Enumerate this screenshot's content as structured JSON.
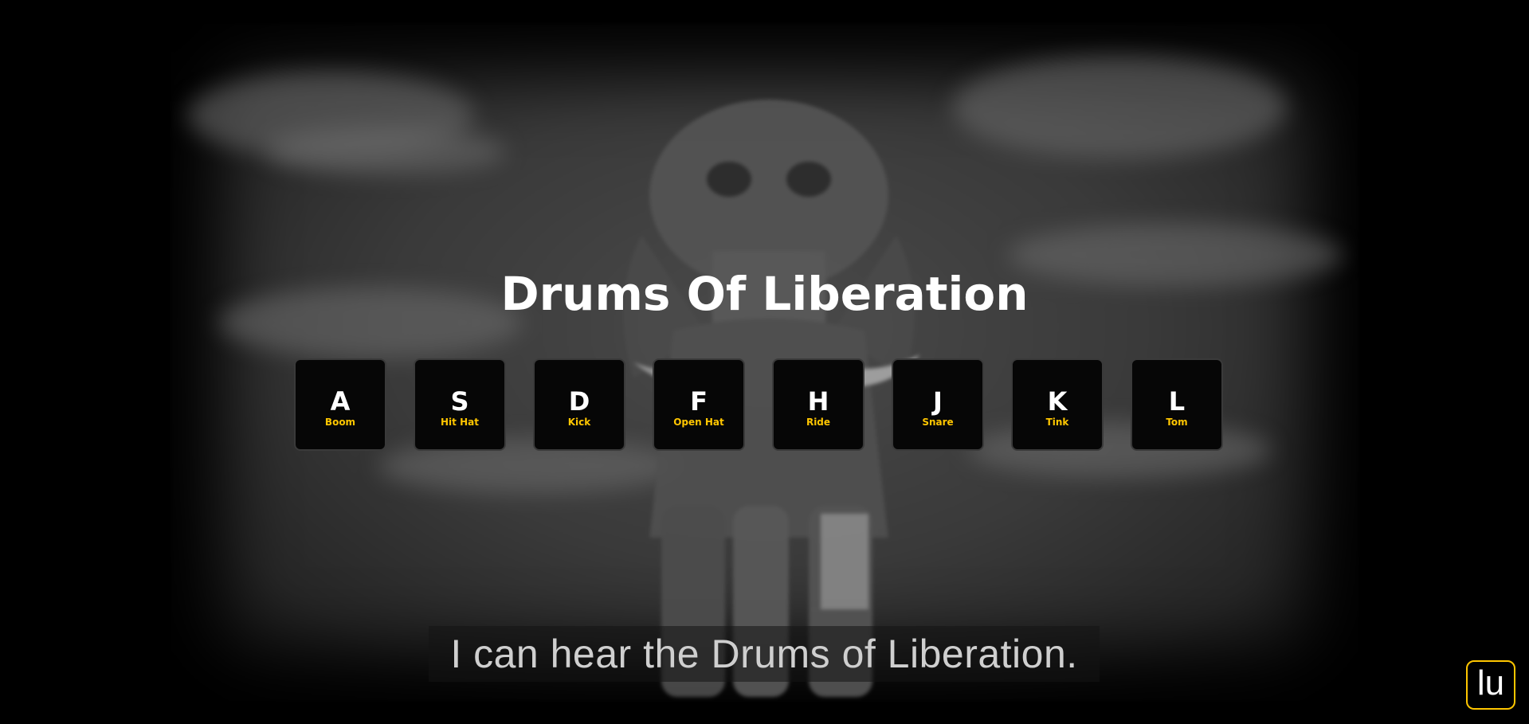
{
  "title": "Drums Of Liberation",
  "keys": [
    {
      "letter": "A",
      "sound": "Boom"
    },
    {
      "letter": "S",
      "sound": "Hit Hat"
    },
    {
      "letter": "D",
      "sound": "Kick"
    },
    {
      "letter": "F",
      "sound": "Open Hat"
    },
    {
      "letter": "H",
      "sound": "Ride"
    },
    {
      "letter": "J",
      "sound": "Snare"
    },
    {
      "letter": "K",
      "sound": "Tink"
    },
    {
      "letter": "L",
      "sound": "Tom"
    }
  ],
  "subtitle": "I can hear the Drums of Liberation.",
  "badge": "lu",
  "colors": {
    "accent": "#ffc600",
    "key_background": "#060606",
    "key_border": "#3a3a3a",
    "page_background": "#000000"
  },
  "background_image": "elephant-under-cloudy-sky"
}
